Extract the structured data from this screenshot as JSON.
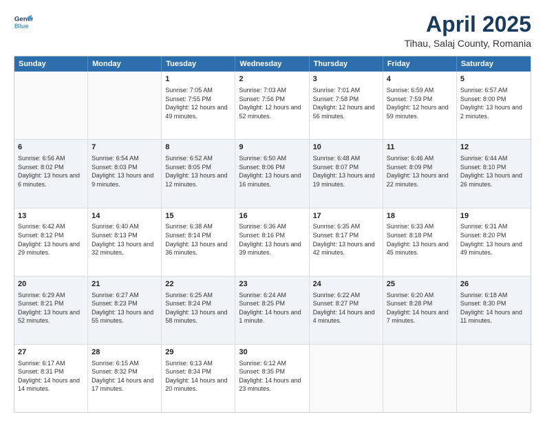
{
  "logo": {
    "line1": "General",
    "line2": "Blue"
  },
  "title": "April 2025",
  "subtitle": "Tihau, Salaj County, Romania",
  "header_days": [
    "Sunday",
    "Monday",
    "Tuesday",
    "Wednesday",
    "Thursday",
    "Friday",
    "Saturday"
  ],
  "rows": [
    {
      "alt": false,
      "cells": [
        {
          "day": "",
          "info": ""
        },
        {
          "day": "",
          "info": ""
        },
        {
          "day": "1",
          "info": "Sunrise: 7:05 AM\nSunset: 7:55 PM\nDaylight: 12 hours and 49 minutes."
        },
        {
          "day": "2",
          "info": "Sunrise: 7:03 AM\nSunset: 7:56 PM\nDaylight: 12 hours and 52 minutes."
        },
        {
          "day": "3",
          "info": "Sunrise: 7:01 AM\nSunset: 7:58 PM\nDaylight: 12 hours and 56 minutes."
        },
        {
          "day": "4",
          "info": "Sunrise: 6:59 AM\nSunset: 7:59 PM\nDaylight: 12 hours and 59 minutes."
        },
        {
          "day": "5",
          "info": "Sunrise: 6:57 AM\nSunset: 8:00 PM\nDaylight: 13 hours and 2 minutes."
        }
      ]
    },
    {
      "alt": true,
      "cells": [
        {
          "day": "6",
          "info": "Sunrise: 6:56 AM\nSunset: 8:02 PM\nDaylight: 13 hours and 6 minutes."
        },
        {
          "day": "7",
          "info": "Sunrise: 6:54 AM\nSunset: 8:03 PM\nDaylight: 13 hours and 9 minutes."
        },
        {
          "day": "8",
          "info": "Sunrise: 6:52 AM\nSunset: 8:05 PM\nDaylight: 13 hours and 12 minutes."
        },
        {
          "day": "9",
          "info": "Sunrise: 6:50 AM\nSunset: 8:06 PM\nDaylight: 13 hours and 16 minutes."
        },
        {
          "day": "10",
          "info": "Sunrise: 6:48 AM\nSunset: 8:07 PM\nDaylight: 13 hours and 19 minutes."
        },
        {
          "day": "11",
          "info": "Sunrise: 6:46 AM\nSunset: 8:09 PM\nDaylight: 13 hours and 22 minutes."
        },
        {
          "day": "12",
          "info": "Sunrise: 6:44 AM\nSunset: 8:10 PM\nDaylight: 13 hours and 26 minutes."
        }
      ]
    },
    {
      "alt": false,
      "cells": [
        {
          "day": "13",
          "info": "Sunrise: 6:42 AM\nSunset: 8:12 PM\nDaylight: 13 hours and 29 minutes."
        },
        {
          "day": "14",
          "info": "Sunrise: 6:40 AM\nSunset: 8:13 PM\nDaylight: 13 hours and 32 minutes."
        },
        {
          "day": "15",
          "info": "Sunrise: 6:38 AM\nSunset: 8:14 PM\nDaylight: 13 hours and 36 minutes."
        },
        {
          "day": "16",
          "info": "Sunrise: 6:36 AM\nSunset: 8:16 PM\nDaylight: 13 hours and 39 minutes."
        },
        {
          "day": "17",
          "info": "Sunrise: 6:35 AM\nSunset: 8:17 PM\nDaylight: 13 hours and 42 minutes."
        },
        {
          "day": "18",
          "info": "Sunrise: 6:33 AM\nSunset: 8:18 PM\nDaylight: 13 hours and 45 minutes."
        },
        {
          "day": "19",
          "info": "Sunrise: 6:31 AM\nSunset: 8:20 PM\nDaylight: 13 hours and 49 minutes."
        }
      ]
    },
    {
      "alt": true,
      "cells": [
        {
          "day": "20",
          "info": "Sunrise: 6:29 AM\nSunset: 8:21 PM\nDaylight: 13 hours and 52 minutes."
        },
        {
          "day": "21",
          "info": "Sunrise: 6:27 AM\nSunset: 8:23 PM\nDaylight: 13 hours and 55 minutes."
        },
        {
          "day": "22",
          "info": "Sunrise: 6:25 AM\nSunset: 8:24 PM\nDaylight: 13 hours and 58 minutes."
        },
        {
          "day": "23",
          "info": "Sunrise: 6:24 AM\nSunset: 8:25 PM\nDaylight: 14 hours and 1 minute."
        },
        {
          "day": "24",
          "info": "Sunrise: 6:22 AM\nSunset: 8:27 PM\nDaylight: 14 hours and 4 minutes."
        },
        {
          "day": "25",
          "info": "Sunrise: 6:20 AM\nSunset: 8:28 PM\nDaylight: 14 hours and 7 minutes."
        },
        {
          "day": "26",
          "info": "Sunrise: 6:18 AM\nSunset: 8:30 PM\nDaylight: 14 hours and 11 minutes."
        }
      ]
    },
    {
      "alt": false,
      "cells": [
        {
          "day": "27",
          "info": "Sunrise: 6:17 AM\nSunset: 8:31 PM\nDaylight: 14 hours and 14 minutes."
        },
        {
          "day": "28",
          "info": "Sunrise: 6:15 AM\nSunset: 8:32 PM\nDaylight: 14 hours and 17 minutes."
        },
        {
          "day": "29",
          "info": "Sunrise: 6:13 AM\nSunset: 8:34 PM\nDaylight: 14 hours and 20 minutes."
        },
        {
          "day": "30",
          "info": "Sunrise: 6:12 AM\nSunset: 8:35 PM\nDaylight: 14 hours and 23 minutes."
        },
        {
          "day": "",
          "info": ""
        },
        {
          "day": "",
          "info": ""
        },
        {
          "day": "",
          "info": ""
        }
      ]
    }
  ]
}
